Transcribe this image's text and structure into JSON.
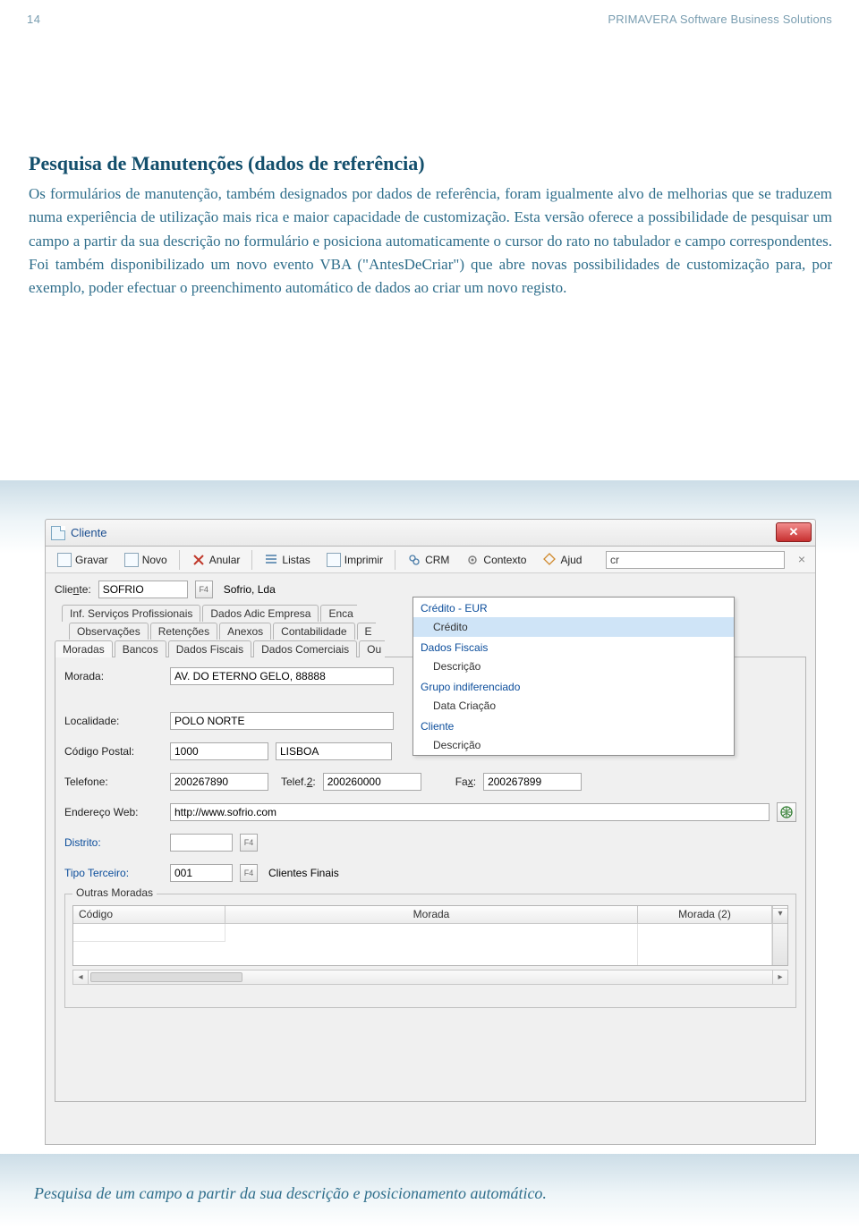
{
  "page": {
    "number": "14",
    "brand": "PRIMAVERA Software Business Solutions"
  },
  "article": {
    "heading": "Pesquisa de Manutenções (dados de referência)",
    "body": "Os formulários de manutenção, também designados por dados de referência, foram igualmente alvo de melhorias que se traduzem numa experiência de utilização mais rica e maior capacidade de customização. Esta versão oferece a possibilidade de pesquisar um campo a partir da sua descrição no formulário e posiciona automaticamente o cursor do rato no tabulador e campo correspondentes. Foi também disponibilizado um novo evento VBA (\"AntesDeCriar\") que abre novas possibilidades de customização para, por exemplo, poder efectuar o preenchimento automático de dados ao criar um novo registo."
  },
  "caption": "Pesquisa de um campo a partir da sua descrição e posicionamento automático.",
  "window": {
    "title": "Cliente",
    "toolbar": {
      "gravar": "Gravar",
      "novo": "Novo",
      "anular": "Anular",
      "listas": "Listas",
      "imprimir": "Imprimir",
      "crm": "CRM",
      "contexto": "Contexto",
      "ajuda": "Ajud",
      "search_value": "cr",
      "clear": "×"
    },
    "client": {
      "label_pre": "Clie",
      "label_ul": "n",
      "label_post": "te:",
      "code": "SOFRIO",
      "name": "Sofrio, Lda"
    },
    "tabs_row1": [
      "Inf. Serviços Profissionais",
      "Dados Adic Empresa",
      "Enca"
    ],
    "tabs_row2_a": {
      "pre1": "",
      "ul1": "O",
      "post1": "bservações"
    },
    "tabs_row2_b": {
      "pre1": "R",
      "ul1": "e",
      "post1": "tenções"
    },
    "tabs_row2_c": {
      "pre1": "",
      "ul1": "A",
      "post1": "nexos"
    },
    "tabs_row2_d": "Contabilidade",
    "tabs_row2_e": "E",
    "tabs_row3_a": "Moradas",
    "tabs_row3_b": {
      "pre1": "",
      "ul1": "B",
      "post1": "ancos"
    },
    "tabs_row3_c": {
      "pre1": "",
      "ul1": "D",
      "post1": "ados Fiscais"
    },
    "tabs_row3_d": {
      "pre1": "D",
      "ul1": "a",
      "post1": "dos Comerciais"
    },
    "tabs_row3_e": "Ou",
    "form": {
      "morada_label_pre": "Mor",
      "morada_label_ul": "a",
      "morada_label_post": "da:",
      "morada": "AV. DO ETERNO GELO, 88888",
      "localidade_label": "Localidade:",
      "localidade": "POLO NORTE",
      "cp_label_pre": "Código ",
      "cp_label_ul": "P",
      "cp_label_post": "ostal:",
      "cp_code": "1000",
      "cp_city": "LISBOA",
      "tel_label_pre": "Telefo",
      "tel_label_ul": "n",
      "tel_label_post": "e:",
      "phone": "200267890",
      "tel2_label_pre": "Telef.",
      "tel2_label_ul": "2",
      "tel2_label_post": ":",
      "phone2": "200260000",
      "fax_label_pre": "Fa",
      "fax_label_ul": "x",
      "fax_label_post": ":",
      "fax": "200267899",
      "web_label_pre": "Endereço ",
      "web_label_ul": "W",
      "web_label_post": "eb:",
      "web": "http://www.sofrio.com",
      "distrito_label": "Distrito:",
      "tipo_label": "Tipo Terceiro:",
      "tipo_code": "001",
      "tipo_desc": "Clientes Finais",
      "f4": "F4"
    },
    "fieldset": {
      "legend": "Outras Moradas",
      "cols": {
        "codigo": "Código",
        "morada": "Morada",
        "morada2": "Morada (2)"
      }
    },
    "suggest": {
      "g1": "Crédito - EUR",
      "i1": "Crédito",
      "g2": "Dados Fiscais",
      "i2": "Descrição",
      "g3": "Grupo indiferenciado",
      "i3": "Data Criação",
      "g4": "Cliente",
      "i4": "Descrição"
    }
  }
}
